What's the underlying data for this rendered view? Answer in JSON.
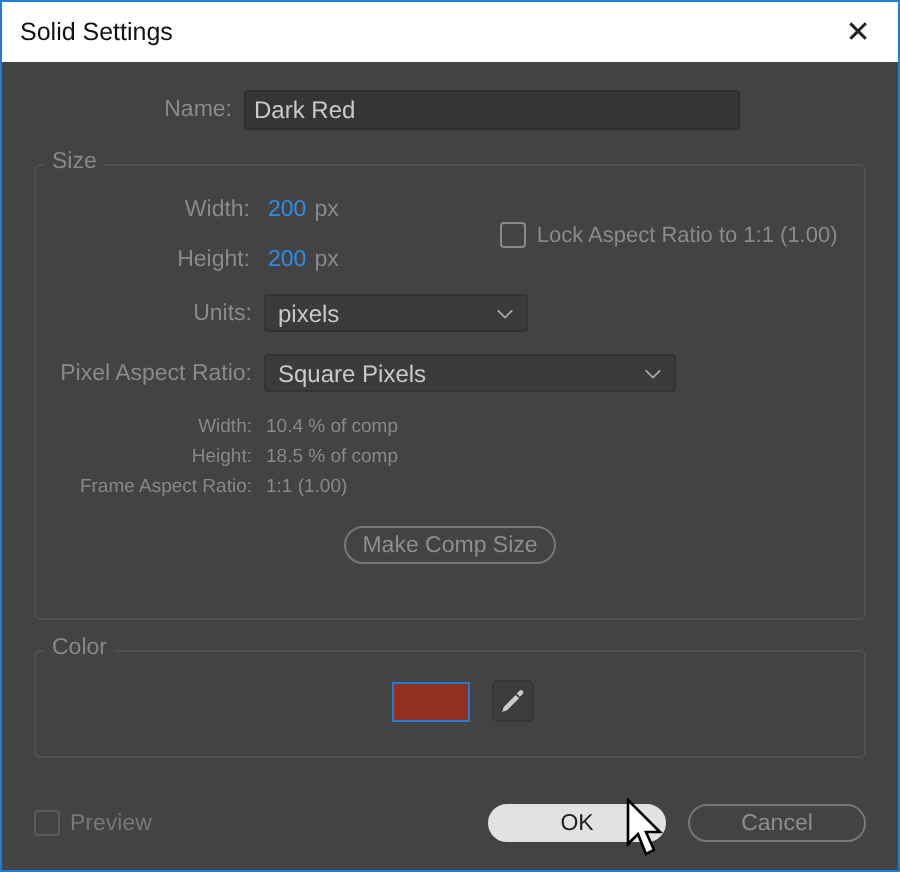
{
  "window": {
    "title": "Solid Settings",
    "close": "✕"
  },
  "name": {
    "label": "Name:",
    "value": "Dark Red"
  },
  "size": {
    "legend": "Size",
    "width": {
      "label": "Width:",
      "value": "200",
      "unit": "px"
    },
    "height": {
      "label": "Height:",
      "value": "200",
      "unit": "px"
    },
    "lock": {
      "label": "Lock Aspect Ratio to 1:1 (1.00)",
      "checked": false
    },
    "units": {
      "label": "Units:",
      "value": "pixels"
    },
    "pixel_aspect_ratio": {
      "label": "Pixel Aspect Ratio:",
      "value": "Square Pixels"
    },
    "info": [
      {
        "label": "Width:",
        "value": "10.4 % of comp"
      },
      {
        "label": "Height:",
        "value": "18.5 % of comp"
      },
      {
        "label": "Frame Aspect Ratio:",
        "value": "1:1 (1.00)"
      }
    ],
    "make_comp_size": "Make Comp Size"
  },
  "color": {
    "legend": "Color",
    "color": "#933021"
  },
  "preview": {
    "label": "Preview",
    "checked": false,
    "disabled": true
  },
  "buttons": [
    {
      "label": "OK",
      "kind": "primary"
    },
    {
      "label": "Cancel",
      "kind": "secondary"
    }
  ]
}
